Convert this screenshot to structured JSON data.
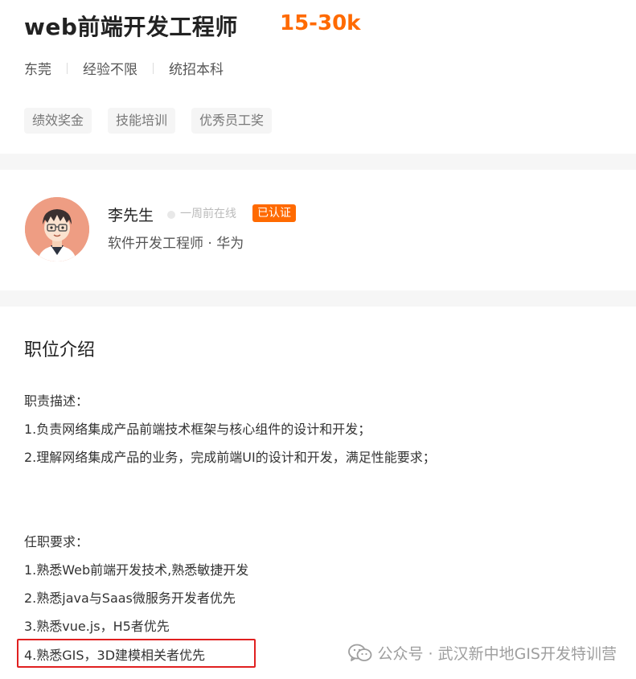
{
  "job": {
    "title": "web前端开发工程师",
    "salary": "15-30k",
    "city": "东莞",
    "experience": "经验不限",
    "education": "统招本科",
    "tags": [
      "绩效奖金",
      "技能培训",
      "优秀员工奖"
    ]
  },
  "recruiter": {
    "name": "李先生",
    "online_status": "一周前在线",
    "verified_badge": "已认证",
    "title_company": "软件开发工程师 · 华为"
  },
  "description": {
    "heading": "职位介绍",
    "lines": [
      "职责描述：",
      "1.负责网络集成产品前端技术框架与核心组件的设计和开发；",
      "2.理解网络集成产品的业务，完成前端UI的设计和开发，满足性能要求；",
      "",
      "",
      "任职要求：",
      "1.熟悉Web前端开发技术,熟悉敏捷开发",
      "2.熟悉java与Saas微服务开发者优先",
      "3.熟悉vue.js，H5者优先",
      "4.熟悉GIS，3D建模相关者优先"
    ]
  },
  "watermark": {
    "text": "公众号 · 武汉新中地GIS开发特训营",
    "icon": "wechat-icon"
  },
  "colors": {
    "accent": "#ff6a00",
    "highlight_border": "#e02020",
    "band": "#f6f6f6"
  }
}
